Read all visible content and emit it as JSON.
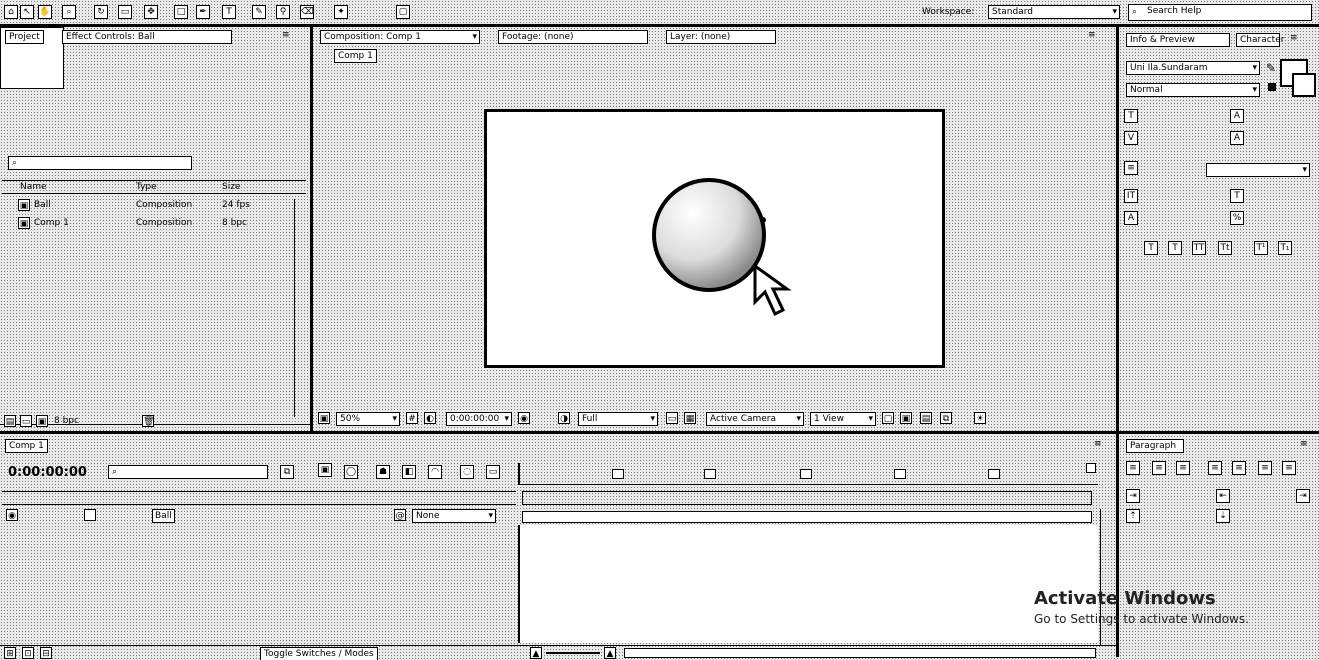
{
  "toolbar": {
    "workspace_label": "Workspace:",
    "workspace_value": "Standard",
    "search_help": "Search Help"
  },
  "project_panel": {
    "tab": "Project",
    "tab2": "Effect Controls: Ball",
    "search_placeholder": "",
    "columns": [
      "Name",
      "Type",
      "Size"
    ],
    "items": [
      {
        "name": "Ball",
        "type": "Composition",
        "size": "24 fps"
      },
      {
        "name": "Comp 1",
        "type": "Composition",
        "size": "8 bpc"
      }
    ],
    "footer_bpc": "8 bpc"
  },
  "comp_panel": {
    "tab": "Composition: Comp 1",
    "tab2": "Footage: (none)",
    "tab3": "Layer: (none)",
    "breadcrumb": "Comp 1",
    "zoom": "50%",
    "resolution": "Full",
    "camera": "Active Camera",
    "views": "1 View",
    "timecode": "0:00:00:00"
  },
  "character_panel": {
    "tab": "Info & Preview",
    "tab2": "Character",
    "font": "Uni Ila.Sundaram",
    "style": "Normal"
  },
  "timeline": {
    "tab": "Comp 1",
    "timecode": "0:00:00:00",
    "layer_name": "Ball",
    "parent": "None",
    "toggle_label": "Toggle Switches / Modes"
  },
  "paragraph_panel": {
    "tab": "Paragraph"
  },
  "watermark": {
    "title": "Activate Windows",
    "subtitle": "Go to Settings to activate Windows."
  }
}
